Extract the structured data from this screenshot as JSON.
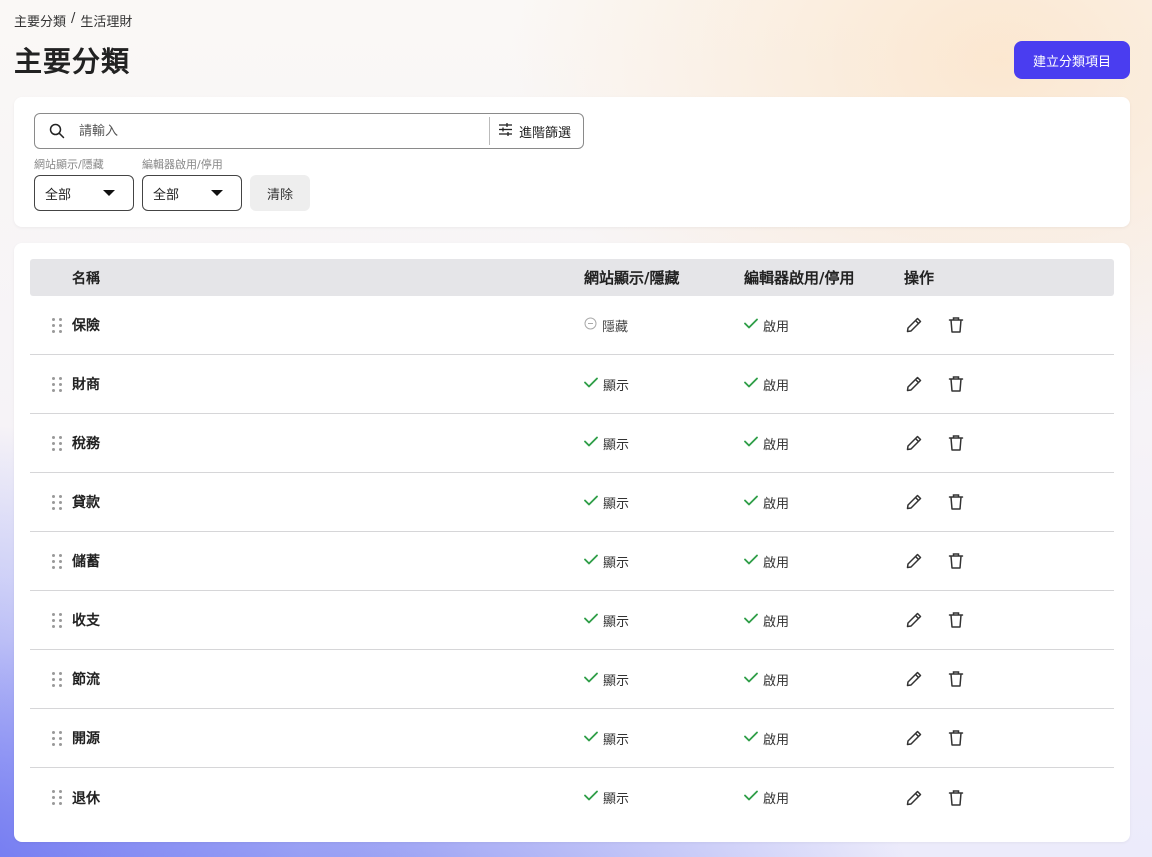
{
  "breadcrumb": {
    "parent": "主要分類",
    "separator": "/",
    "current": "生活理財"
  },
  "page_title": "主要分類",
  "create_button": "建立分類項目",
  "search": {
    "placeholder": "請輸入",
    "value": "",
    "advanced_label": "進階篩選"
  },
  "filters": {
    "visibility": {
      "label": "網站顯示/隱藏",
      "value": "全部"
    },
    "editor": {
      "label": "編輯器啟用/停用",
      "value": "全部"
    },
    "clear_label": "清除"
  },
  "table": {
    "headers": {
      "name": "名稱",
      "visibility": "網站顯示/隱藏",
      "editor": "編輯器啟用/停用",
      "actions": "操作"
    },
    "rows": [
      {
        "name": "保險",
        "visibility": "隱藏",
        "visibility_state": "hidden",
        "editor": "啟用"
      },
      {
        "name": "財商",
        "visibility": "顯示",
        "visibility_state": "shown",
        "editor": "啟用"
      },
      {
        "name": "稅務",
        "visibility": "顯示",
        "visibility_state": "shown",
        "editor": "啟用"
      },
      {
        "name": "貸款",
        "visibility": "顯示",
        "visibility_state": "shown",
        "editor": "啟用"
      },
      {
        "name": "儲蓄",
        "visibility": "顯示",
        "visibility_state": "shown",
        "editor": "啟用"
      },
      {
        "name": "收支",
        "visibility": "顯示",
        "visibility_state": "shown",
        "editor": "啟用"
      },
      {
        "name": "節流",
        "visibility": "顯示",
        "visibility_state": "shown",
        "editor": "啟用"
      },
      {
        "name": "開源",
        "visibility": "顯示",
        "visibility_state": "shown",
        "editor": "啟用"
      },
      {
        "name": "退休",
        "visibility": "顯示",
        "visibility_state": "shown",
        "editor": "啟用"
      }
    ]
  },
  "colors": {
    "accent": "#4a3df0",
    "check": "#2e9e47",
    "muted_icon": "#aaaaaa"
  }
}
